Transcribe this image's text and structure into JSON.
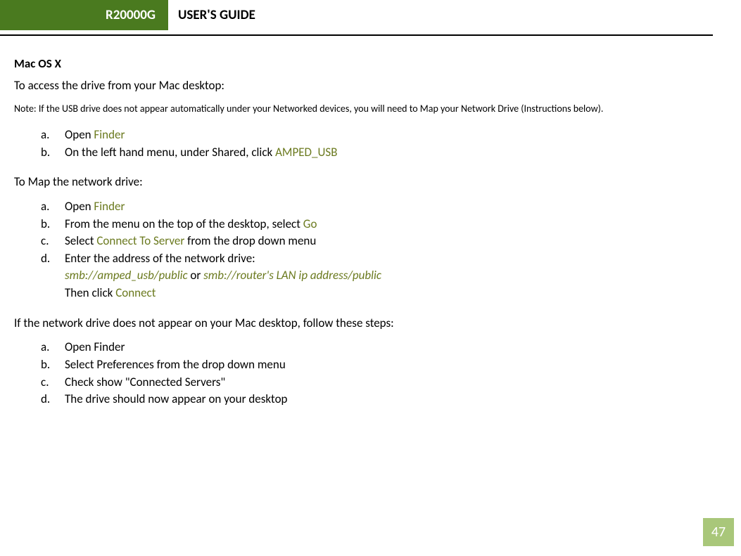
{
  "header": {
    "badge": "R20000G",
    "title": "USER'S GUIDE"
  },
  "section_title": "Mac OS X",
  "intro": "To access the drive from your Mac desktop:",
  "note": "Note: If the USB drive does not appear automatically under your Networked devices, you will need to Map your Network Drive (Instructions below).",
  "list1": {
    "a": {
      "pre": "Open ",
      "olive": "Finder"
    },
    "b": {
      "pre": "On the left hand menu, under Shared, click ",
      "olive": "AMPED_USB"
    }
  },
  "map_heading": "To Map the network drive:",
  "list2": {
    "a": {
      "pre": "Open ",
      "olive": "Finder"
    },
    "b": {
      "pre": "From the menu on the top of the desktop, select ",
      "olive": "Go"
    },
    "c": {
      "pre": "Select ",
      "olive": "Connect To Server",
      "post": " from the drop down menu"
    },
    "d": {
      "line1": "Enter the address of the network drive:",
      "addr1": "smb://amped_usb/public",
      "or": "  or  ",
      "addr2": "smb://router's LAN ip address/public",
      "then_pre": "Then click ",
      "then_olive": "Connect"
    }
  },
  "if_heading": "If the network drive does not appear on your Mac desktop, follow these steps:",
  "list3": {
    "a": "Open Finder",
    "b": "Select Preferences from the drop down menu",
    "c": "Check show \"Connected Servers\"",
    "d": "The drive should now appear on your desktop"
  },
  "page_number": "47",
  "markers": {
    "a": "a.",
    "b": "b.",
    "c": "c.",
    "d": "d."
  }
}
